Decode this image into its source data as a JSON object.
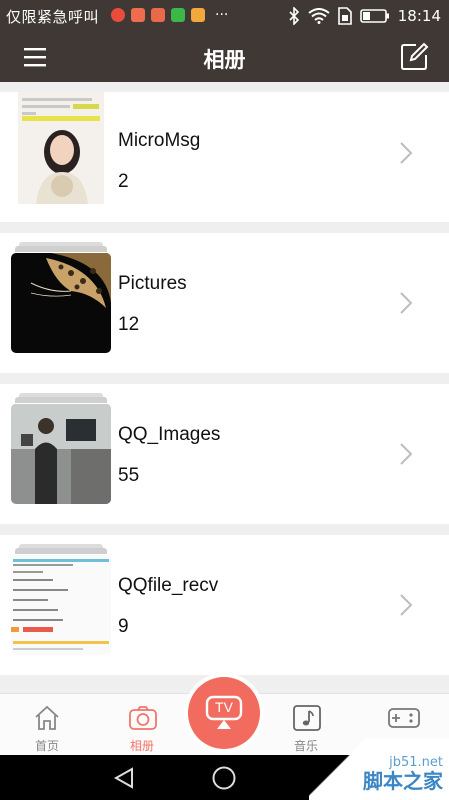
{
  "status_bar": {
    "carrier": "仅限紧急呼叫",
    "more": "···",
    "time": "18:14",
    "app_colors": [
      "#e74c3c",
      "#f06c4f",
      "#e96a4a",
      "#3cb84a",
      "#f2a83b"
    ]
  },
  "header": {
    "title": "相册"
  },
  "albums": [
    {
      "name": "MicroMsg",
      "count": "2"
    },
    {
      "name": "Pictures",
      "count": "12"
    },
    {
      "name": "QQ_Images",
      "count": "55"
    },
    {
      "name": "QQfile_recv",
      "count": "9"
    }
  ],
  "bottom_nav": {
    "items": [
      {
        "label": "首页"
      },
      {
        "label": "相册"
      },
      {
        "label": "音乐"
      },
      {
        "label": ""
      }
    ],
    "tv_label": "TV",
    "active_color": "#f26b5f"
  },
  "watermark": {
    "line1": "jb51.net",
    "line2": "脚本之家"
  }
}
